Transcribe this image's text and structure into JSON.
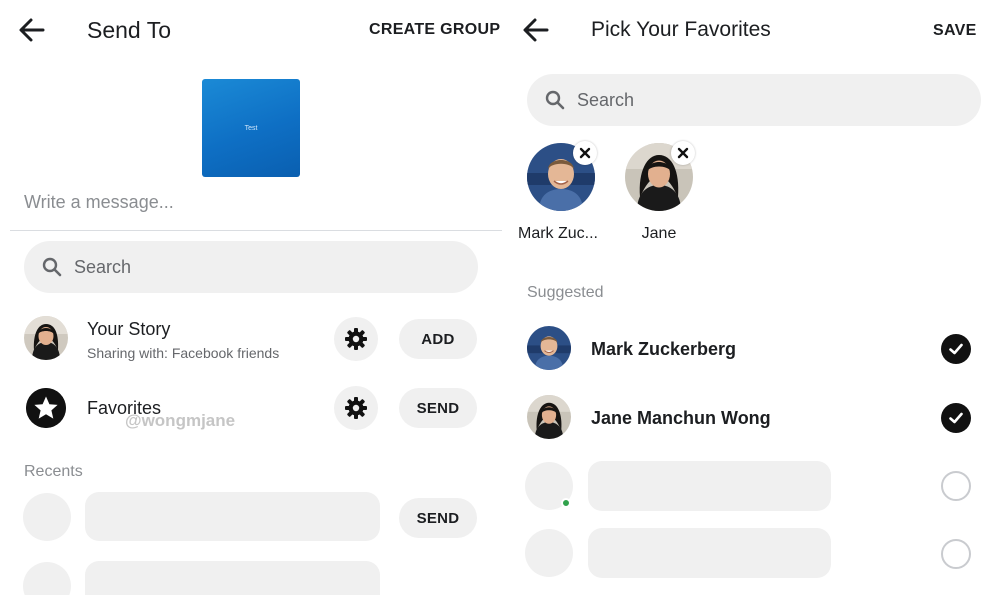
{
  "send_to": {
    "title": "Send To",
    "create_group_label": "CREATE GROUP",
    "preview_text": "Test",
    "message_placeholder": "Write a message...",
    "search_placeholder": "Search",
    "story": {
      "title": "Your Story",
      "subtitle": "Sharing with: Facebook friends",
      "action_label": "ADD"
    },
    "favorites": {
      "title": "Favorites",
      "action_label": "SEND"
    },
    "watermark": "@wongmjane",
    "recents_label": "Recents",
    "recent_action_label": "SEND"
  },
  "pick_favorites": {
    "title": "Pick Your Favorites",
    "save_label": "SAVE",
    "search_placeholder": "Search",
    "selected": [
      {
        "name": "Mark Zuc..."
      },
      {
        "name": "Jane"
      }
    ],
    "suggested_label": "Suggested",
    "suggested": [
      {
        "name": "Mark Zuckerberg",
        "checked": true
      },
      {
        "name": "Jane Manchun Wong",
        "checked": true
      }
    ]
  },
  "colors": {
    "accent_blue": "#0e6fc4",
    "surface_gray": "#f0f0f0",
    "check_black": "#111111",
    "online_green": "#31a24c"
  }
}
